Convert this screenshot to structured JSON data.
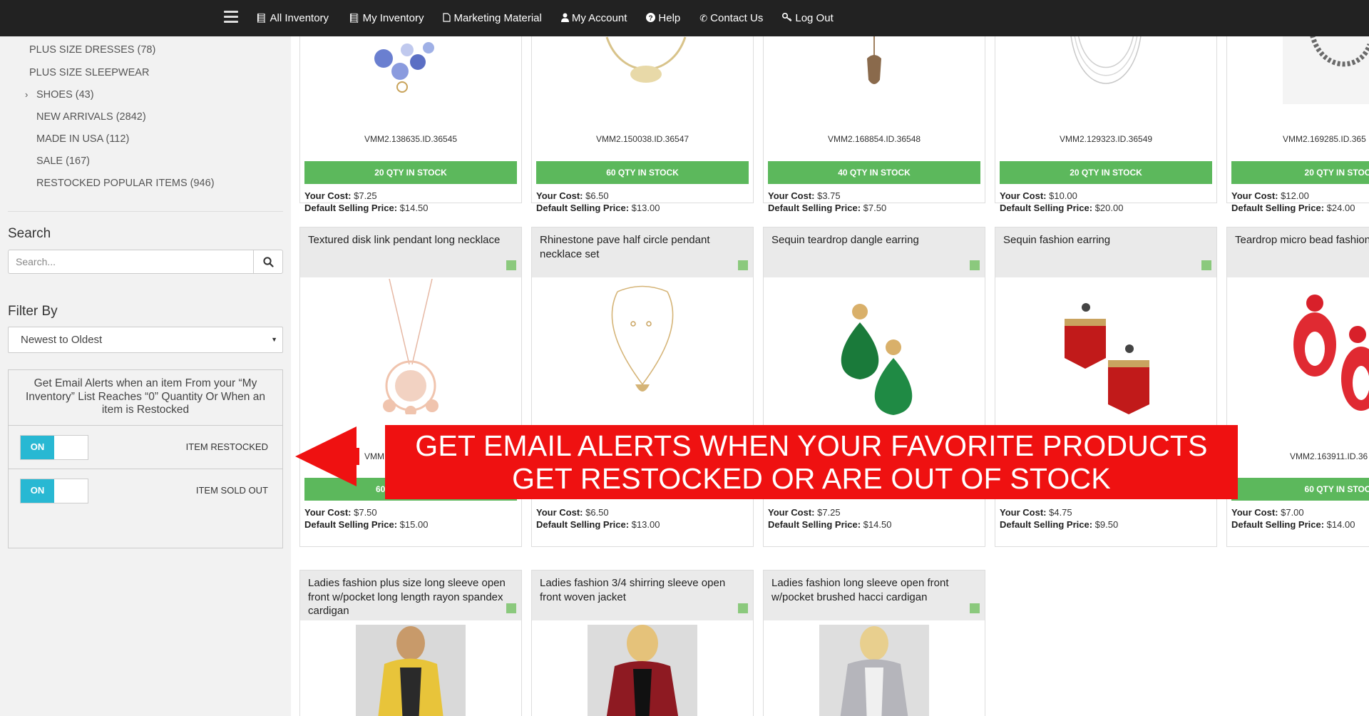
{
  "nav": {
    "items": [
      {
        "label": "All Inventory",
        "icon": "book-icon"
      },
      {
        "label": "My Inventory",
        "icon": "book-icon"
      },
      {
        "label": "Marketing Material",
        "icon": "file-icon"
      },
      {
        "label": "My Account",
        "icon": "user-icon"
      },
      {
        "label": "Help",
        "icon": "question-icon"
      },
      {
        "label": "Contact Us",
        "icon": "phone-icon"
      },
      {
        "label": "Log Out",
        "icon": "key-icon"
      }
    ]
  },
  "sidebar": {
    "categories": [
      "PLUS SIZE DRESSES (78)",
      "PLUS SIZE SLEEPWEAR",
      "SHOES (43)",
      "NEW ARRIVALS (2842)",
      "MADE IN USA (112)",
      "SALE (167)",
      "RESTOCKED POPULAR ITEMS (946)"
    ],
    "search_heading": "Search",
    "search_placeholder": "Search...",
    "filter_heading": "Filter By",
    "filter_value": "Newest to Oldest",
    "alert_text": "Get Email Alerts when an item From your “My Inventory” List Reaches “0” Quantity Or When an item is Restocked",
    "toggle_on": "ON",
    "alert_restocked": "ITEM RESTOCKED",
    "alert_soldout": "ITEM SOLD OUT"
  },
  "row1": [
    {
      "sku": "VMM2.138635.ID.36545",
      "stock": "20 QTY IN STOCK",
      "cost": "$7.25",
      "sell": "$14.50"
    },
    {
      "sku": "VMM2.150038.ID.36547",
      "stock": "60 QTY IN STOCK",
      "cost": "$6.50",
      "sell": "$13.00"
    },
    {
      "sku": "VMM2.168854.ID.36548",
      "stock": "40 QTY IN STOCK",
      "cost": "$3.75",
      "sell": "$7.50"
    },
    {
      "sku": "VMM2.129323.ID.36549",
      "stock": "20 QTY IN STOCK",
      "cost": "$10.00",
      "sell": "$20.00"
    },
    {
      "sku": "VMM2.169285.ID.365",
      "stock": "20 QTY IN STOC",
      "cost": "$12.00",
      "sell": "$24.00"
    }
  ],
  "row2": [
    {
      "title": "Textured disk link pendant long necklace",
      "sku": "VMM",
      "stock": "60",
      "cost": "$7.50",
      "sell": "$15.00"
    },
    {
      "title": "Rhinestone pave half circle pendant necklace set",
      "sku": "",
      "stock": "",
      "cost": "$6.50",
      "sell": "$13.00"
    },
    {
      "title": "Sequin teardrop dangle earring",
      "sku": "",
      "stock": "",
      "cost": "$7.25",
      "sell": "$14.50"
    },
    {
      "title": "Sequin fashion earring",
      "sku": "",
      "stock": "",
      "cost": "$4.75",
      "sell": "$9.50"
    },
    {
      "title": "Teardrop micro bead fashion",
      "sku": "VMM2.163911.ID.36",
      "stock": "60 QTY IN STOC",
      "cost": "$7.00",
      "sell": "$14.00"
    }
  ],
  "row3": [
    {
      "title": "Ladies fashion plus size long sleeve open front w/pocket long length rayon spandex cardigan"
    },
    {
      "title": "Ladies fashion 3/4 shirring sleeve open front woven jacket"
    },
    {
      "title": "Ladies fashion long sleeve open front w/pocket brushed hacci cardigan"
    }
  ],
  "labels": {
    "your_cost": "Your Cost:",
    "default_price": "Default Selling Price:"
  },
  "callout": {
    "line1": "GET EMAIL ALERTS WHEN YOUR FAVORITE PRODUCTS",
    "line2": "GET RESTOCKED OR ARE OUT OF STOCK"
  },
  "colors": {
    "nav_bg": "#222222",
    "stock_green": "#5cb85c",
    "toggle_blue": "#28b8d3",
    "callout_red": "#ef1111"
  }
}
